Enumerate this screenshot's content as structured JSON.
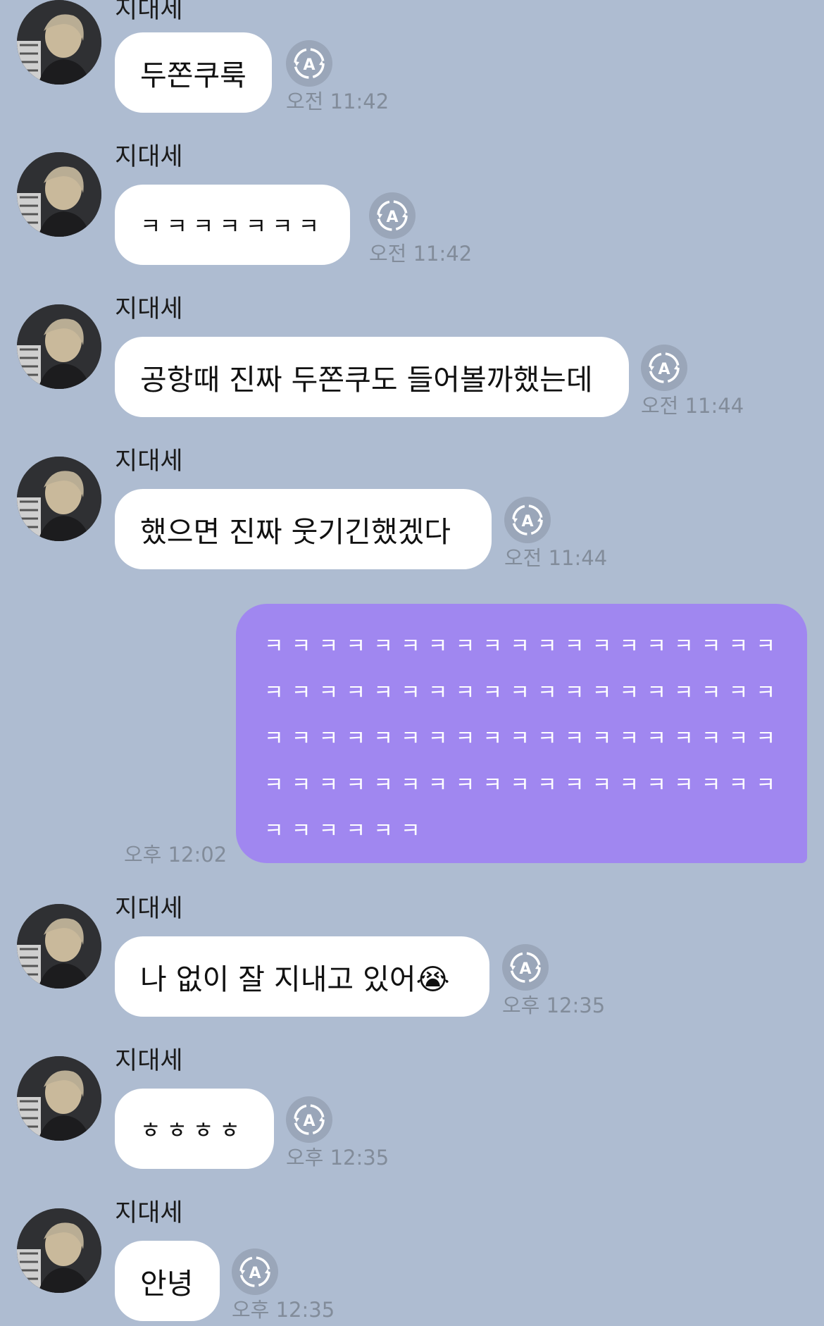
{
  "conversation": {
    "messages": [
      {
        "sender": "지대세",
        "text": "두쫀쿠룩",
        "time": "오전 11:42"
      },
      {
        "sender": "지대세",
        "text": "ㅋㅋㅋㅋㅋㅋㅋ",
        "time": "오전 11:42"
      },
      {
        "sender": "지대세",
        "text": "공항때 진짜 두쫀쿠도 들어볼까했는데",
        "time": "오전 11:44"
      },
      {
        "sender": "지대세",
        "text": "했으면 진짜 웃기긴했겠다",
        "time": "오전 11:44"
      },
      {
        "sender": "지대세",
        "text": "나 없이 잘 지내고 있어😭",
        "time": "오후 12:35"
      },
      {
        "sender": "지대세",
        "text": "ㅎㅎㅎㅎ",
        "time": "오후 12:35"
      },
      {
        "sender": "지대세",
        "text": "안녕",
        "time": "오후 12:35"
      }
    ],
    "my_message": {
      "lines": [
        "ㅋㅋㅋㅋㅋㅋㅋㅋㅋㅋㅋㅋㅋㅋㅋㅋㅋㅋㅋ",
        "ㅋㅋㅋㅋㅋㅋㅋㅋㅋㅋㅋㅋㅋㅋㅋㅋㅋㅋㅋ",
        "ㅋㅋㅋㅋㅋㅋㅋㅋㅋㅋㅋㅋㅋㅋㅋㅋㅋㅋㅋ",
        "ㅋㅋㅋㅋㅋㅋㅋㅋㅋㅋㅋㅋㅋㅋㅋㅋㅋㅋㅋ",
        "ㅋㅋㅋㅋㅋㅋ"
      ],
      "time": "오후 12:02"
    }
  },
  "icons": {
    "translate": "translate-icon",
    "avatar": "profile-photo"
  },
  "colors": {
    "background": "#aebcd1",
    "incoming_bubble": "#ffffff",
    "outgoing_bubble": "#a087f0",
    "timestamp": "#828c9a"
  }
}
